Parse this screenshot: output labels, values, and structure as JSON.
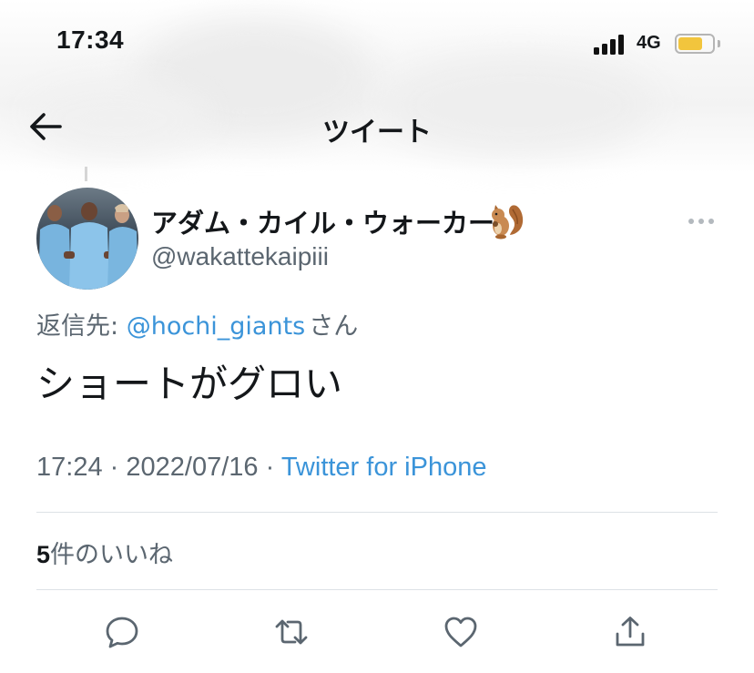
{
  "status_bar": {
    "time": "17:34",
    "network": "4G",
    "battery_color": "#f2c53d",
    "battery_level": 0.72
  },
  "header": {
    "title": "ツイート",
    "back_icon": "arrow-left-icon"
  },
  "tweet": {
    "display_name": "アダム・カイル・ウォーカー",
    "name_emoji": "squirrel-emoji",
    "handle": "@wakattekaipiii",
    "reply_prefix": "返信先:",
    "reply_mention": "@hochi_giants",
    "reply_suffix": "さん",
    "text": "ショートがグロい",
    "time": "17:24",
    "separator": "·",
    "date": "2022/07/16",
    "source": "Twitter for iPhone"
  },
  "stats": {
    "likes_count": "5",
    "likes_label": "件のいいね"
  },
  "actions": [
    {
      "name": "reply",
      "icon": "comment-icon"
    },
    {
      "name": "retweet",
      "icon": "retweet-icon"
    },
    {
      "name": "like",
      "icon": "heart-icon"
    },
    {
      "name": "share",
      "icon": "share-icon"
    }
  ],
  "colors": {
    "link": "#3b94d9",
    "secondary_text": "#5b6670",
    "icon_gray": "#5b6670"
  }
}
